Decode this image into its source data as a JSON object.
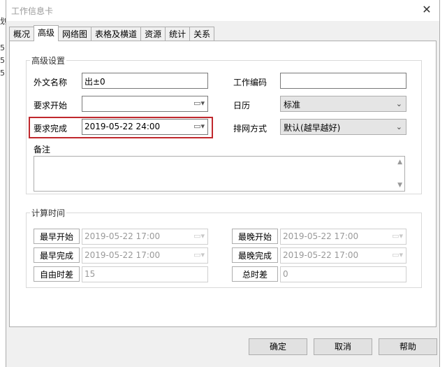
{
  "window": {
    "title": "工作信息卡",
    "close_glyph": "✕"
  },
  "background": {
    "left_text": [
      "划",
      "5",
      "5",
      "5"
    ]
  },
  "tabs": [
    {
      "label": "概况",
      "active": false
    },
    {
      "label": "高级",
      "active": true
    },
    {
      "label": "网络图",
      "active": false
    },
    {
      "label": "表格及横道",
      "active": false
    },
    {
      "label": "资源",
      "active": false
    },
    {
      "label": "统计",
      "active": false
    },
    {
      "label": "关系",
      "active": false
    }
  ],
  "advanced": {
    "group_title": "高级设置",
    "foreign_name": {
      "label": "外文名称",
      "value": "出±0"
    },
    "work_code": {
      "label": "工作编码",
      "value": ""
    },
    "required_start": {
      "label": "要求开始",
      "value": ""
    },
    "calendar": {
      "label": "日历",
      "value": "标准"
    },
    "required_finish": {
      "label": "要求完成",
      "value": "2019-05-22 24:00"
    },
    "scheduling": {
      "label": "排网方式",
      "value": "默认(越早越好)"
    },
    "notes": {
      "label": "备注",
      "value": ""
    }
  },
  "calc": {
    "group_title": "计算时间",
    "earliest_start": {
      "label": "最早开始",
      "value": "2019-05-22 17:00"
    },
    "latest_start": {
      "label": "最晚开始",
      "value": "2019-05-22 17:00"
    },
    "earliest_finish": {
      "label": "最早完成",
      "value": "2019-05-22 17:00"
    },
    "latest_finish": {
      "label": "最晚完成",
      "value": "2019-05-22 17:00"
    },
    "free_float": {
      "label": "自由时差",
      "value": "15"
    },
    "total_float": {
      "label": "总时差",
      "value": "0"
    }
  },
  "buttons": {
    "ok": "确定",
    "cancel": "取消",
    "help": "帮助"
  },
  "colors": {
    "highlight": "#c0282d"
  }
}
